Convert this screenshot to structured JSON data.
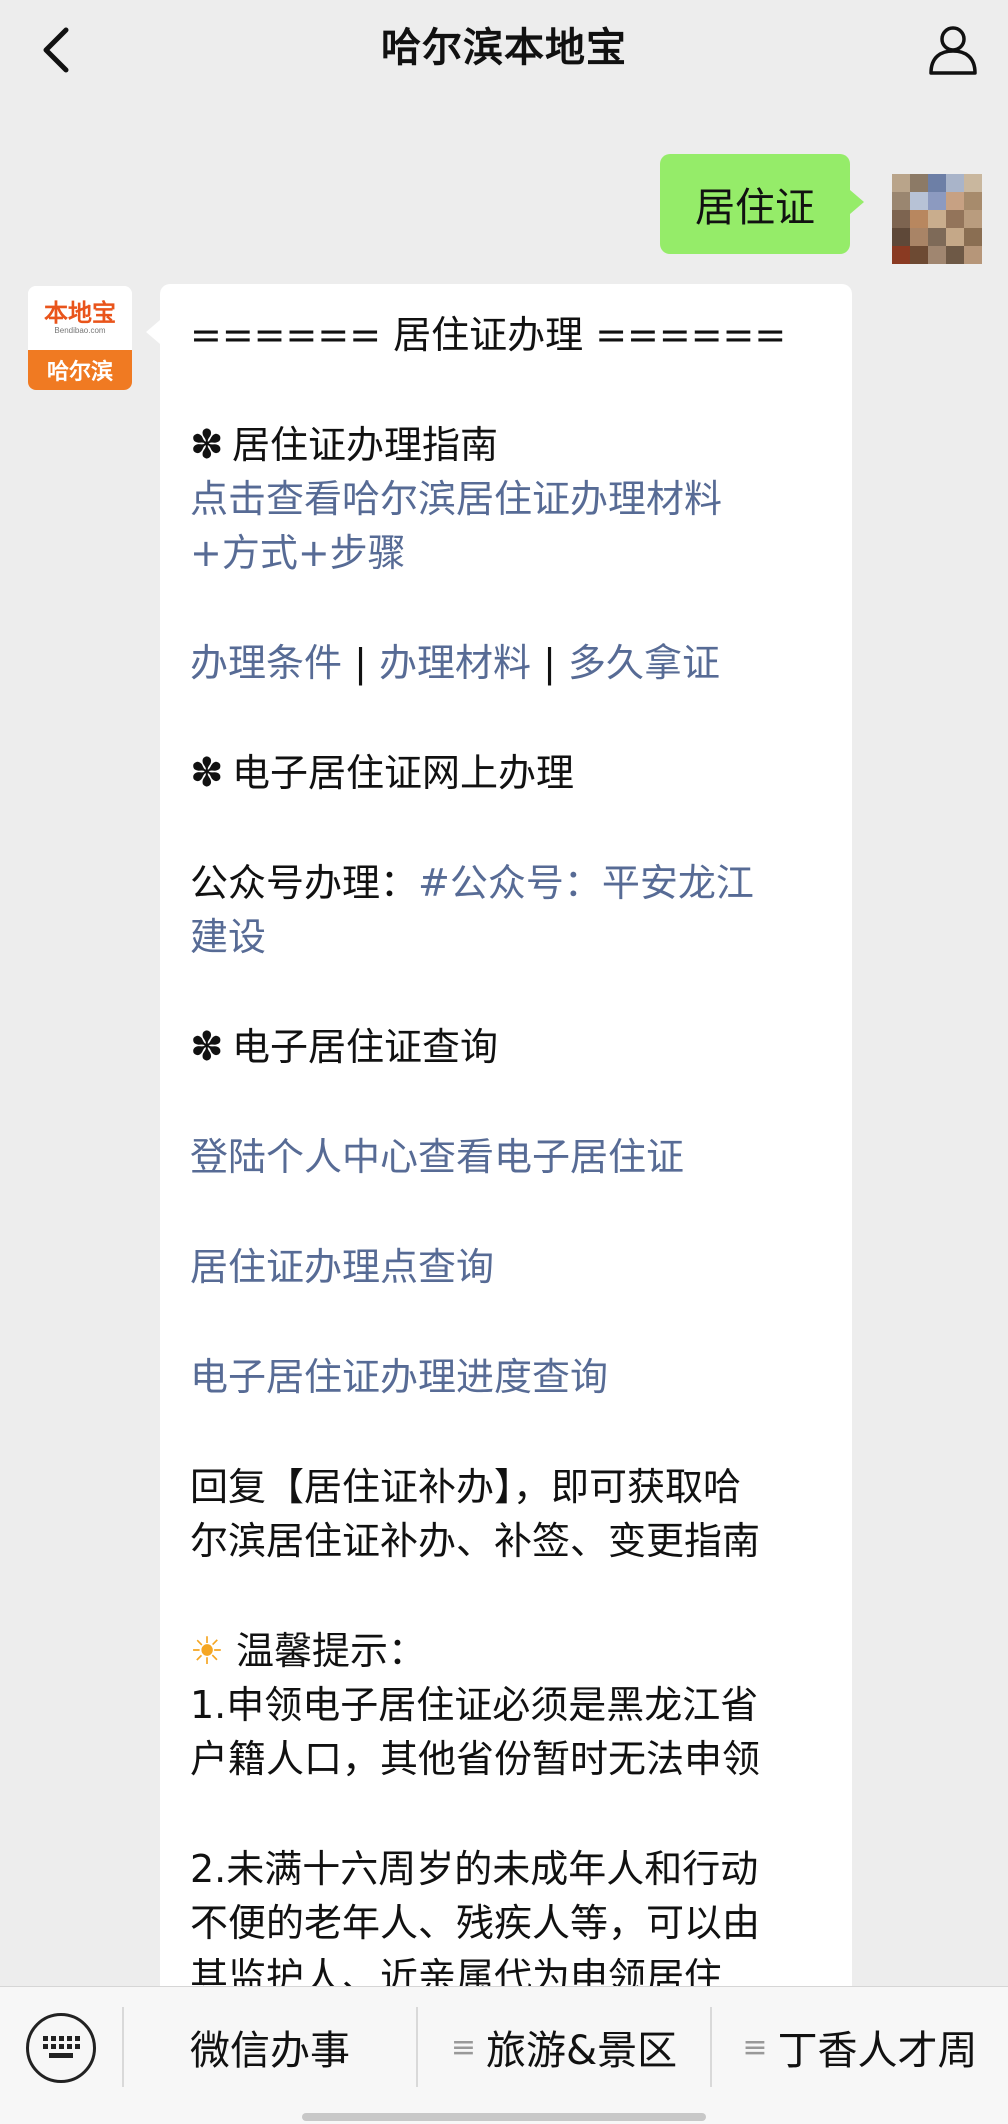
{
  "header": {
    "title": "哈尔滨本地宝",
    "back_icon": "chevron-left-icon",
    "profile_icon": "person-icon"
  },
  "user_message": {
    "text": "居住证",
    "bubble_color": "#95ec69"
  },
  "bot": {
    "avatar": {
      "logo_text": "本地宝",
      "logo_subtext": "Bendibao.com",
      "city": "哈尔滨",
      "brand_color": "#f07a22"
    },
    "message": {
      "heading": "====== 居住证办理 ======",
      "section1_title": "居住证办理指南",
      "guide_link_line1": "点击查看哈尔滨居住证办理材料",
      "guide_link_line2": "+方式+步骤",
      "conditions_link": "办理条件",
      "materials_link": "办理材料",
      "duration_link": "多久拿证",
      "separator": "|",
      "section2_title": "电子居住证网上办理",
      "official_label": "公众号办理：",
      "official_link_line1": "#公众号：平安龙江",
      "official_link_line2": "建设",
      "section3_title": "电子居住证查询",
      "query_links": [
        "登陆个人中心查看电子居住证",
        "居住证办理点查询",
        "电子居住证办理进度查询"
      ],
      "reply_line1": "回复【居住证补办】，即可获取哈",
      "reply_line2": "尔滨居住证补办、补签、变更指南",
      "tip_title": "温馨提示：",
      "tip1_line1": "1.申领电子居住证必须是黑龙江省",
      "tip1_line2": "户籍人口，其他省份暂时无法申领",
      "tip2_line1": "2.未满十六周岁的未成年人和行动",
      "tip2_line2": "不便的老年人、残疾人等，可以由",
      "tip2_line3": "其监护人、近亲属代为申领居住",
      "bullet_glyph": "✽",
      "tip_glyph": "☀",
      "link_color": "#576b95"
    }
  },
  "bottom_menu": {
    "keyboard_icon": "keyboard-icon",
    "items": [
      {
        "label": "微信办事",
        "has_submenu": false
      },
      {
        "label": "旅游&景区",
        "has_submenu": true
      },
      {
        "label": "丁香人才周",
        "has_submenu": true
      }
    ],
    "submenu_glyph": "≡"
  }
}
